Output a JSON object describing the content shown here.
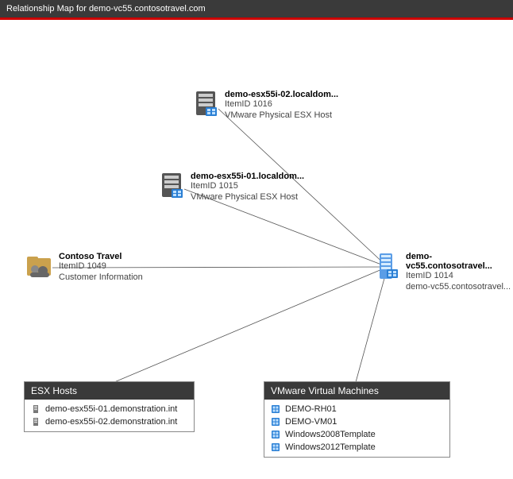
{
  "title": "Relationship Map for demo-vc55.contosotravel.com",
  "chart_data": {
    "type": "diagram",
    "title": "Relationship Map for demo-vc55.contosotravel.com",
    "nodes": [
      {
        "id": "esx02",
        "label": "demo-esx55i-02.localdom...",
        "item_id": "ItemID 1016",
        "subtype": "VMware Physical ESX Host",
        "kind": "host"
      },
      {
        "id": "esx01",
        "label": "demo-esx55i-01.localdom...",
        "item_id": "ItemID 1015",
        "subtype": "VMware Physical ESX Host",
        "kind": "host"
      },
      {
        "id": "contoso",
        "label": "Contoso Travel",
        "item_id": "ItemID 1049",
        "subtype": "Customer Information",
        "kind": "customer"
      },
      {
        "id": "vc55",
        "label": "demo-vc55.contosotravel...",
        "item_id": "ItemID 1014",
        "subtype": "demo-vc55.contosotravel...",
        "kind": "vcenter"
      },
      {
        "id": "grp_esx",
        "label": "ESX Hosts",
        "kind": "group"
      },
      {
        "id": "grp_vm",
        "label": "VMware Virtual Machines",
        "kind": "group"
      }
    ],
    "edges": [
      {
        "from": "vc55",
        "to": "esx02"
      },
      {
        "from": "vc55",
        "to": "esx01"
      },
      {
        "from": "vc55",
        "to": "contoso"
      },
      {
        "from": "vc55",
        "to": "grp_esx"
      },
      {
        "from": "vc55",
        "to": "grp_vm"
      }
    ],
    "groups": {
      "grp_esx": [
        "demo-esx55i-01.demonstration.int",
        "demo-esx55i-02.demonstration.int"
      ],
      "grp_vm": [
        "DEMO-RH01",
        "DEMO-VM01",
        "Windows2008Template",
        "Windows2012Template"
      ]
    }
  },
  "nodes": {
    "esx02": {
      "name": "demo-esx55i-02.localdom...",
      "id": "ItemID 1016",
      "type": "VMware Physical ESX Host"
    },
    "esx01": {
      "name": "demo-esx55i-01.localdom...",
      "id": "ItemID 1015",
      "type": "VMware Physical ESX Host"
    },
    "contoso": {
      "name": "Contoso Travel",
      "id": "ItemID 1049",
      "type": "Customer Information"
    },
    "vc55": {
      "name": "demo-vc55.contosotravel...",
      "id": "ItemID 1014",
      "type": "demo-vc55.contosotravel..."
    }
  },
  "panels": {
    "esx": {
      "title": "ESX Hosts",
      "items": [
        {
          "name": "demo-esx55i-01.demonstration.int"
        },
        {
          "name": "demo-esx55i-02.demonstration.int"
        }
      ]
    },
    "vms": {
      "title": "VMware Virtual Machines",
      "items": [
        {
          "name": "DEMO-RH01"
        },
        {
          "name": "DEMO-VM01"
        },
        {
          "name": "Windows2008Template"
        },
        {
          "name": "Windows2012Template"
        }
      ]
    }
  }
}
